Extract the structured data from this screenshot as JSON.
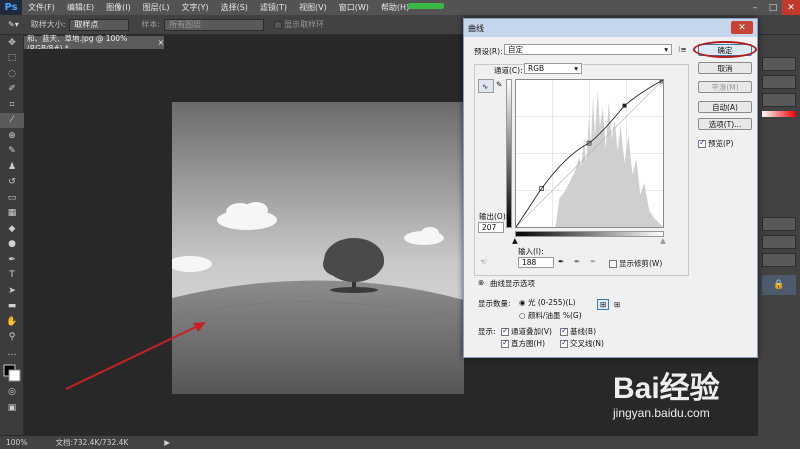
{
  "app": {
    "logo": "Ps"
  },
  "menu": [
    "文件(F)",
    "编辑(E)",
    "图像(I)",
    "图层(L)",
    "文字(Y)",
    "选择(S)",
    "滤镜(T)",
    "视图(V)",
    "窗口(W)",
    "帮助(H)"
  ],
  "options_bar": {
    "sample_size_label": "取样大小:",
    "sample_size_value": "取样点",
    "sample_label": "样本:",
    "sample_value": "所有图层",
    "show_ring_label": "显示取样环"
  },
  "document": {
    "tab_title": "和、蓝天、草地.jpg @ 100%(RGB/8#) *"
  },
  "status": {
    "zoom": "100%",
    "doc_info": "文档:732.4K/732.4K"
  },
  "watermark": {
    "brand": "Bai经验",
    "url": "jingyan.baidu.com"
  },
  "curves": {
    "title": "曲线",
    "preset_label": "预设(R):",
    "preset_value": "自定",
    "channel_label": "通道(C):",
    "channel_value": "RGB",
    "output_label": "输出(O):",
    "output_value": "207",
    "input_label": "输入(I):",
    "input_value": "188",
    "show_clipping_label": "显示修剪(W)",
    "options_section_label": "曲线显示选项",
    "show_amount_label": "显示数量:",
    "light_label": "光 (0-255)(L)",
    "pigment_label": "颜料/油墨 %(G)",
    "show_label": "显示:",
    "channel_overlays_label": "通道叠加(V)",
    "baseline_label": "基线(B)",
    "histogram_label": "直方图(H)",
    "intersection_label": "交叉线(N)",
    "buttons": {
      "ok": "确定",
      "cancel": "取消",
      "smooth": "平滑(M)",
      "auto": "自动(A)",
      "options": "选项(T)...",
      "preview": "预览(P)"
    }
  }
}
